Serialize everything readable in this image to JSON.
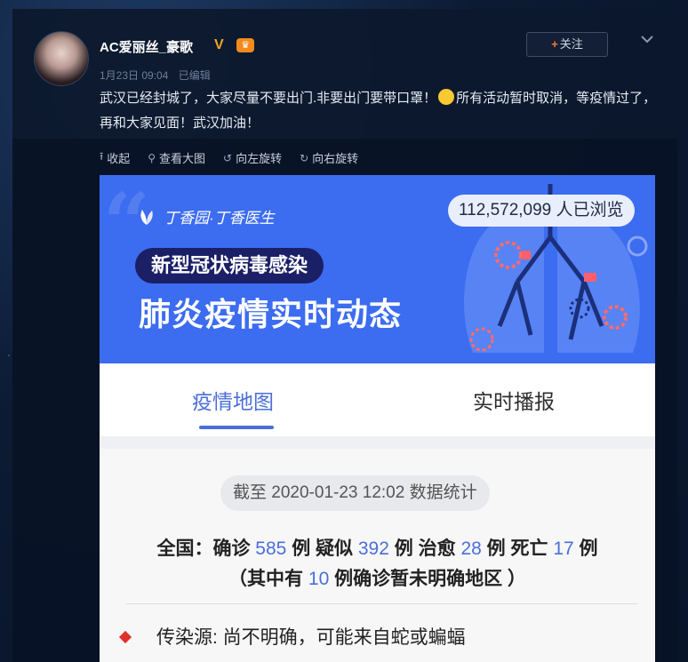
{
  "post": {
    "author": "AC爱丽丝_豪歌",
    "verified_badge": "V",
    "crown_badge": "♛",
    "date": "1月23日 09:04",
    "edited": "已编辑",
    "follow_label": "关注",
    "follow_plus": "+",
    "content_part1": "武汉已经封城了，大家尽量不要出门.非要出门要带口罩！",
    "content_part2": "所有活动暂时取消，等疫情过了，再和大家见面！武汉加油！",
    "emoji_icon": "sweat-smile-emoji"
  },
  "toolbar": {
    "collapse": "收起",
    "view_large": "查看大图",
    "rotate_left": "向左旋转",
    "rotate_right": "向右旋转"
  },
  "image": {
    "brand": "丁香园·丁香医生",
    "views": "112,572,099 人已浏览",
    "pill_title": "新型冠状病毒感染",
    "big_title": "肺炎疫情实时动态",
    "tab_map": "疫情地图",
    "tab_live": "实时播报",
    "date_stat": "截至 2020-01-23 12:02 数据统计",
    "stats": {
      "prefix": "全国：确诊",
      "confirmed": "585",
      "u1": "例 疑似",
      "suspected": "392",
      "u2": "例 治愈",
      "cured": "28",
      "u3": "例 死亡",
      "deaths": "17",
      "u4": "例"
    },
    "stats2": {
      "prefix": "（其中有",
      "unclear": "10",
      "suffix": "例确诊暂未明确地区 ）"
    },
    "source_label": "传染源: 尚不明确，可能来自蛇或蝙蝠"
  },
  "colors": {
    "accent_blue": "#4a6fd8",
    "banner_blue": "#3c6cf0",
    "follow_plus": "#ff7a2e",
    "badge_gold": "#f5a623"
  }
}
